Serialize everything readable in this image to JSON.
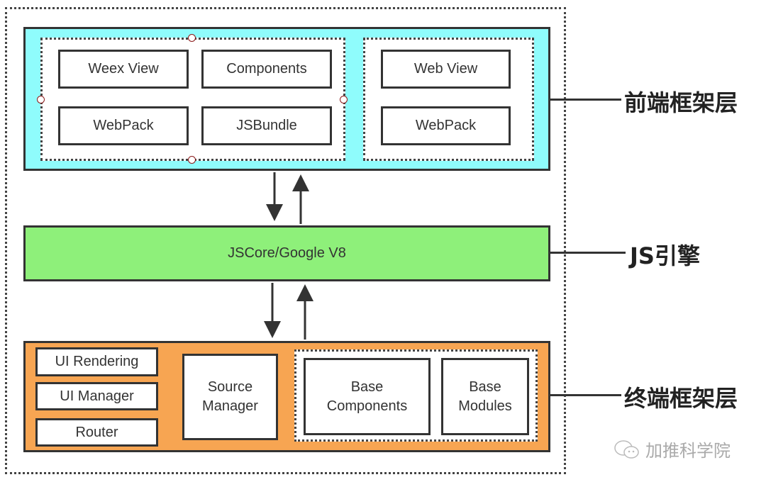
{
  "colors": {
    "frontend": "#8ffcfc",
    "engine": "#8ef07a",
    "native": "#f7a552",
    "stroke": "#333333"
  },
  "frontend": {
    "weex_group": [
      "Weex View",
      "Components",
      "WebPack",
      "JSBundle"
    ],
    "web_group": [
      "Web View",
      "WebPack"
    ],
    "label": "前端框架层"
  },
  "engine": {
    "title": "JSCore/Google V8",
    "label": "JS引擎"
  },
  "native": {
    "left_items": [
      "UI Rendering",
      "UI Manager",
      "Router"
    ],
    "source_manager": "Source\nManager",
    "base_group": [
      "Base\nComponents",
      "Base\nModules"
    ],
    "label": "终端框架层"
  },
  "watermark": {
    "icon": "wechat-icon",
    "text": "加推科学院"
  }
}
